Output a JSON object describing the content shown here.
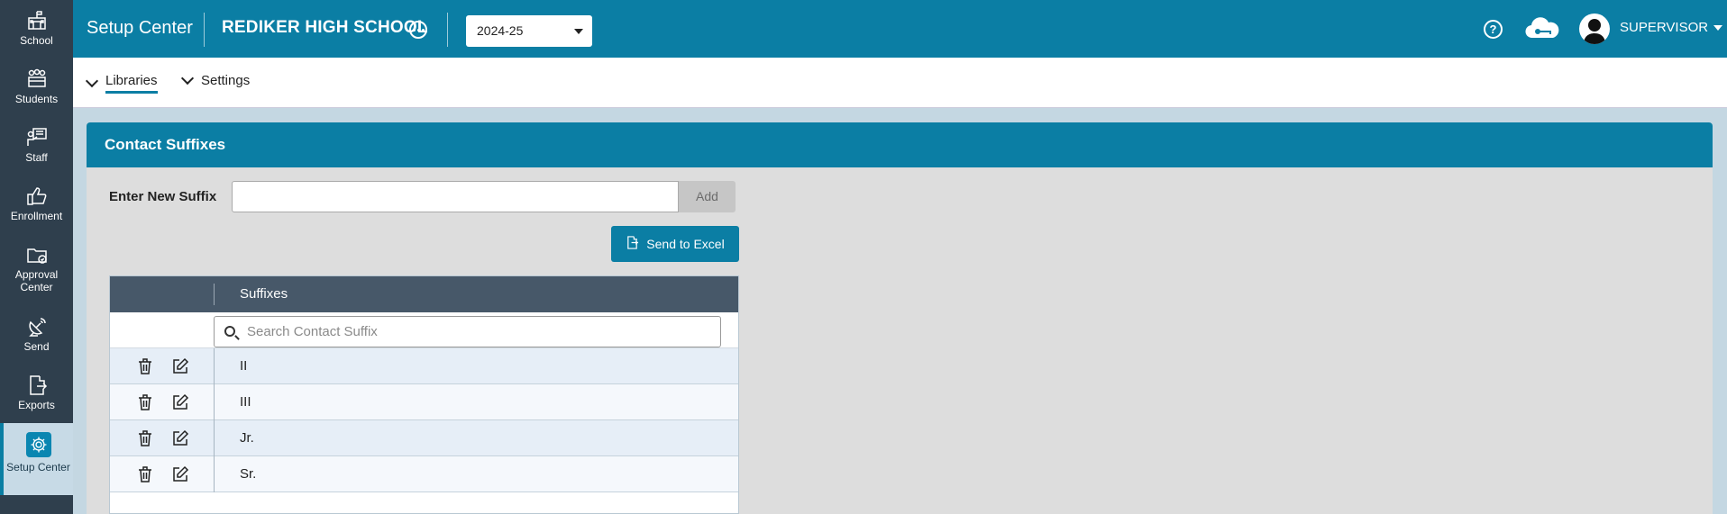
{
  "sidebar": {
    "items": [
      {
        "label": "School",
        "icon": "school-icon"
      },
      {
        "label": "Students",
        "icon": "students-icon"
      },
      {
        "label": "Staff",
        "icon": "staff-icon"
      },
      {
        "label": "Enrollment",
        "icon": "thumbs-up-icon"
      },
      {
        "label": "Approval Center",
        "icon": "folder-check-icon"
      },
      {
        "label": "Send",
        "icon": "satellite-dish-icon"
      },
      {
        "label": "Exports",
        "icon": "export-file-icon"
      },
      {
        "label": "Setup Center",
        "icon": "gear-icon",
        "active": true
      }
    ]
  },
  "header": {
    "app_title": "Setup Center",
    "school_name": "REDIKER HIGH SCHOOL",
    "school_year": "2024-25",
    "user": "SUPERVISOR",
    "help_icon": "question-circle-icon",
    "cloud_icon": "cloud-key-icon"
  },
  "subnav": {
    "items": [
      {
        "label": "Libraries",
        "active": true
      },
      {
        "label": "Settings",
        "active": false
      }
    ]
  },
  "panel": {
    "title": "Contact Suffixes",
    "enter_label": "Enter New Suffix",
    "input_value": "",
    "add_label": "Add",
    "excel_label": "Send to Excel",
    "grid": {
      "column": "Suffixes",
      "search_placeholder": "Search Contact Suffix",
      "rows": [
        "II",
        "III",
        "Jr.",
        "Sr."
      ]
    }
  },
  "colors": {
    "primary": "#0b7ea4",
    "sidebar": "#2f3f4d",
    "grid_header": "#475869"
  }
}
